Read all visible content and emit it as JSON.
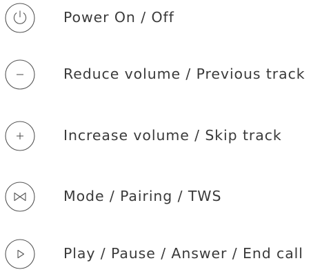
{
  "controls": [
    {
      "icon": "power-icon",
      "label": "Power On / Off"
    },
    {
      "icon": "minus-icon",
      "label": "Reduce volume / Previous track"
    },
    {
      "icon": "plus-icon",
      "label": "Increase volume / Skip track"
    },
    {
      "icon": "mode-icon",
      "label": "Mode / Pairing / TWS"
    },
    {
      "icon": "play-icon",
      "label": "Play / Pause / Answer / End call"
    }
  ],
  "colors": {
    "text": "#3a3a3a",
    "icon_stroke": "#555555"
  }
}
